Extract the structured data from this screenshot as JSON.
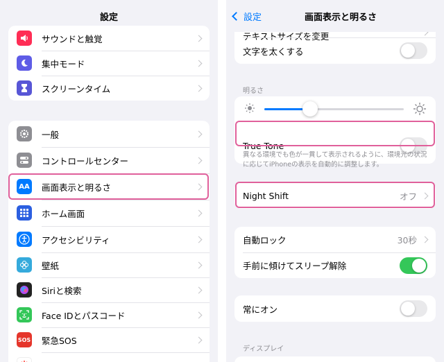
{
  "left": {
    "title": "設定",
    "group1": [
      {
        "label": "サウンドと触覚",
        "icon": "speaker-icon",
        "color": "#ff2d55"
      },
      {
        "label": "集中モード",
        "icon": "moon-icon",
        "color": "#5e5ce6"
      },
      {
        "label": "スクリーンタイム",
        "icon": "hourglass-icon",
        "color": "#5856d6"
      }
    ],
    "group2": [
      {
        "label": "一般",
        "icon": "gear-icon",
        "color": "#8e8e93"
      },
      {
        "label": "コントロールセンター",
        "icon": "toggles-icon",
        "color": "#8e8e93"
      },
      {
        "label": "画面表示と明るさ",
        "icon": "text-size-icon",
        "icon_text": "AA",
        "color": "#007aff"
      },
      {
        "label": "ホーム画面",
        "icon": "home-grid-icon",
        "color": "#2c5fe0"
      },
      {
        "label": "アクセシビリティ",
        "icon": "accessibility-icon",
        "color": "#007aff"
      },
      {
        "label": "壁紙",
        "icon": "wallpaper-icon",
        "color": "#35aadc"
      },
      {
        "label": "Siriと検索",
        "icon": "siri-icon",
        "color": "#222222"
      },
      {
        "label": "Face IDとパスコード",
        "icon": "face-id-icon",
        "color": "#34c759"
      },
      {
        "label": "緊急SOS",
        "icon": "sos-icon",
        "icon_text": "SOS",
        "color": "#e5352b"
      },
      {
        "label": "",
        "icon": "exposure-icon",
        "color": "#ffffff"
      }
    ]
  },
  "right": {
    "back_label": "設定",
    "title": "画面表示と明るさ",
    "group_top": [
      {
        "label": "テキストサイズを変更"
      },
      {
        "label": "文字を太くする",
        "toggle": false
      }
    ],
    "brightness_header": "明るさ",
    "brightness_level": 0.33,
    "true_tone": {
      "label": "True Tone",
      "toggle": false
    },
    "true_tone_note": "異なる環境でも色が一貫して表示されるように、環境光の状況に応じてiPhoneの表示を自動的に調整します。",
    "night_shift": {
      "label": "Night Shift",
      "value": "オフ"
    },
    "auto_lock": {
      "label": "自動ロック",
      "value": "30秒"
    },
    "raise_to_wake": {
      "label": "手前に傾けてスリープ解除",
      "toggle": true
    },
    "always_on": {
      "label": "常にオン",
      "toggle": false
    },
    "display_header": "ディスプレイ"
  },
  "accent": "#007aff",
  "highlight_color": "#e0609b"
}
